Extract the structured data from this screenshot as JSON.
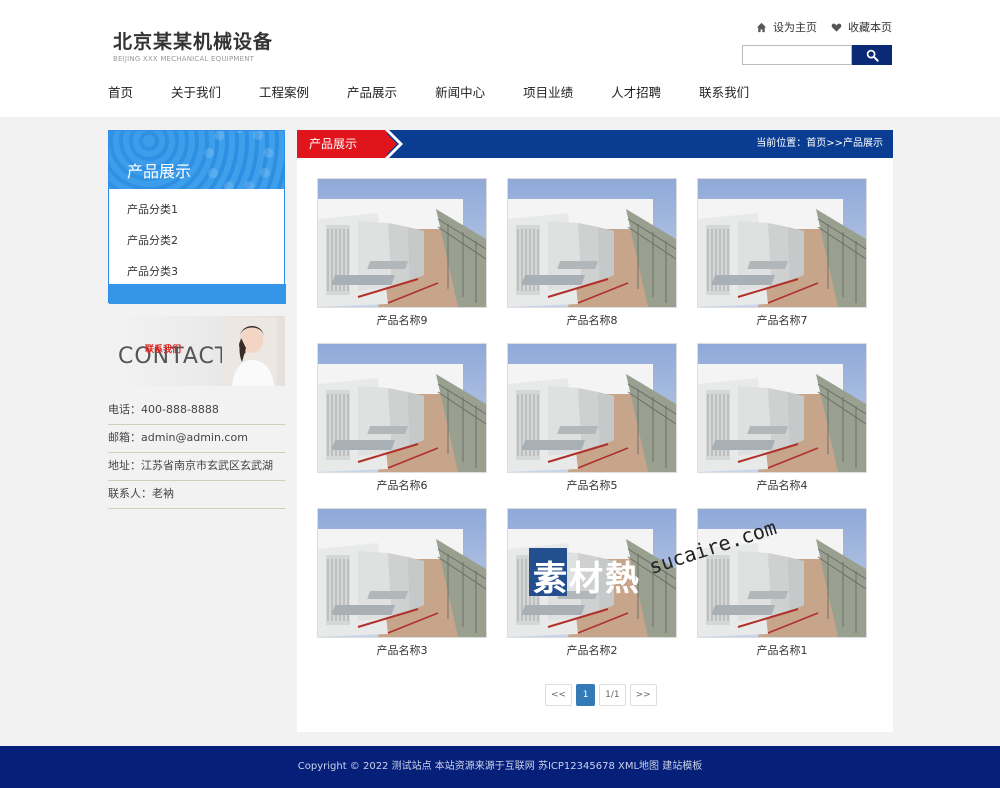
{
  "header": {
    "logo_cn": "北京某某机械设备",
    "logo_en": "BEIJING XXX MECHANICAL EQUIPMENT",
    "set_home": "设为主页",
    "bookmark": "收藏本页",
    "search_placeholder": ""
  },
  "nav": [
    "首页",
    "关于我们",
    "工程案例",
    "产品展示",
    "新闻中心",
    "项目业绩",
    "人才招聘",
    "联系我们"
  ],
  "sidebar": {
    "title": "产品展示",
    "items": [
      "产品分类1",
      "产品分类2",
      "产品分类3"
    ],
    "contact_banner_cn": "联系我们",
    "contact_banner_en": "CONTACT US",
    "contacts": [
      "电话：400-888-8888",
      "邮箱：admin@admin.com",
      "地址：江苏省南京市玄武区玄武湖",
      "联系人：老衲"
    ]
  },
  "main": {
    "tab": "产品展示",
    "breadcrumb_prefix": "当前位置：",
    "breadcrumb_home": "首页",
    "breadcrumb_sep": ">>",
    "breadcrumb_current": "产品展示",
    "products": [
      "产品名称9",
      "产品名称8",
      "产品名称7",
      "产品名称6",
      "产品名称5",
      "产品名称4",
      "产品名称3",
      "产品名称2",
      "产品名称1"
    ],
    "pager": {
      "first": "<<",
      "current": "1",
      "info": "1/1",
      "last": ">>"
    }
  },
  "watermark": {
    "cn": "素材熱",
    "url": "sucaire.com"
  },
  "footer": {
    "copyright": "Copyright © 2022 测试站点 本站资源来源于互联网 苏ICP12345678 XML地图 建站模板"
  },
  "colors": {
    "nav_blue": "#0a3d91",
    "accent_red": "#e0141b",
    "sidebar_blue": "#3595e6",
    "footer_blue": "#061f78"
  }
}
